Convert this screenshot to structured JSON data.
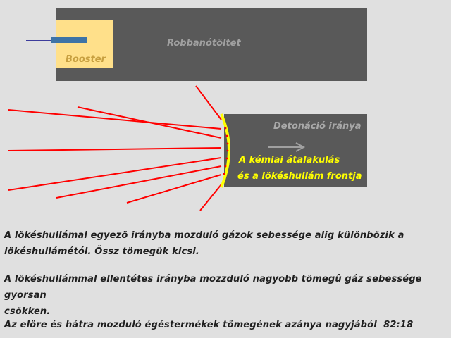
{
  "labels": {
    "booster": "Booster",
    "charge": "Robbanótöltet",
    "direction": "Detonáció iránya",
    "front_line1": "A kémiai átalakulás",
    "front_line2": "és a lökéshullám frontja"
  },
  "paragraphs": [
    {
      "line1": "A lökéshullámal egyezö irányba mozduló gázok sebessége alig különbözik a",
      "line2": "lökéshullámétól. Össz tömegük kicsi."
    },
    {
      "line1": "A lökéshullámmal ellentétes irányba mozzduló nagyobb tömegû gáz sebessége gyorsan",
      "line2": "csökken."
    },
    {
      "line1": "Az elöre és hátra mozduló égéstermékek tömegének azánya nagyjából  82:18"
    }
  ],
  "colors": {
    "background": "#e0e0e0",
    "charge": "#595959",
    "booster": "#ffe08a",
    "rays": "#ff0000",
    "front": "#ffff00",
    "arrow": "#a0a0a0"
  }
}
